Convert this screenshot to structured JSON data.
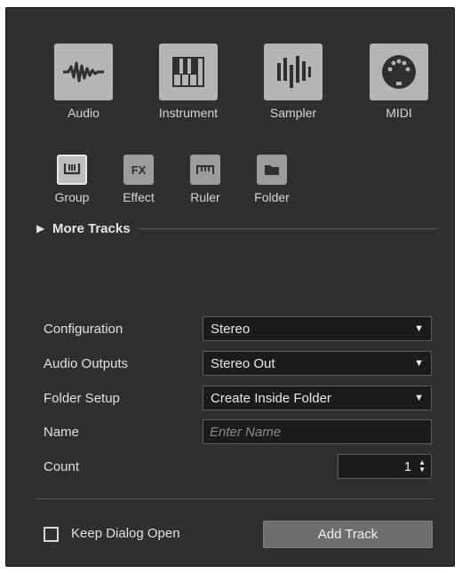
{
  "track_types": [
    {
      "label": "Audio",
      "icon": "audio-waveform-icon"
    },
    {
      "label": "Instrument",
      "icon": "keyboard-icon"
    },
    {
      "label": "Sampler",
      "icon": "sampler-icon"
    },
    {
      "label": "MIDI",
      "icon": "midi-port-icon"
    }
  ],
  "small_types": [
    {
      "label": "Group",
      "icon": "group-icon",
      "selected": true
    },
    {
      "label": "Effect",
      "icon": "fx-icon",
      "icon_text": "FX"
    },
    {
      "label": "Ruler",
      "icon": "ruler-icon"
    },
    {
      "label": "Folder",
      "icon": "folder-icon"
    }
  ],
  "more_tracks": {
    "label": "More Tracks",
    "arrow": "▶"
  },
  "form": {
    "configuration": {
      "label": "Configuration",
      "value": "Stereo"
    },
    "audio_outputs": {
      "label": "Audio Outputs",
      "value": "Stereo Out"
    },
    "folder_setup": {
      "label": "Folder Setup",
      "value": "Create Inside Folder"
    },
    "name": {
      "label": "Name",
      "placeholder": "Enter Name",
      "value": ""
    },
    "count": {
      "label": "Count",
      "value": "1"
    }
  },
  "footer": {
    "keep_open_label": "Keep Dialog Open",
    "keep_open_checked": false,
    "add_track_label": "Add Track"
  },
  "colors": {
    "background": "#2e2f30",
    "icon_tile": "#b5b5b5",
    "field_background": "#1b1b1b",
    "button": "#6e6e6e"
  }
}
